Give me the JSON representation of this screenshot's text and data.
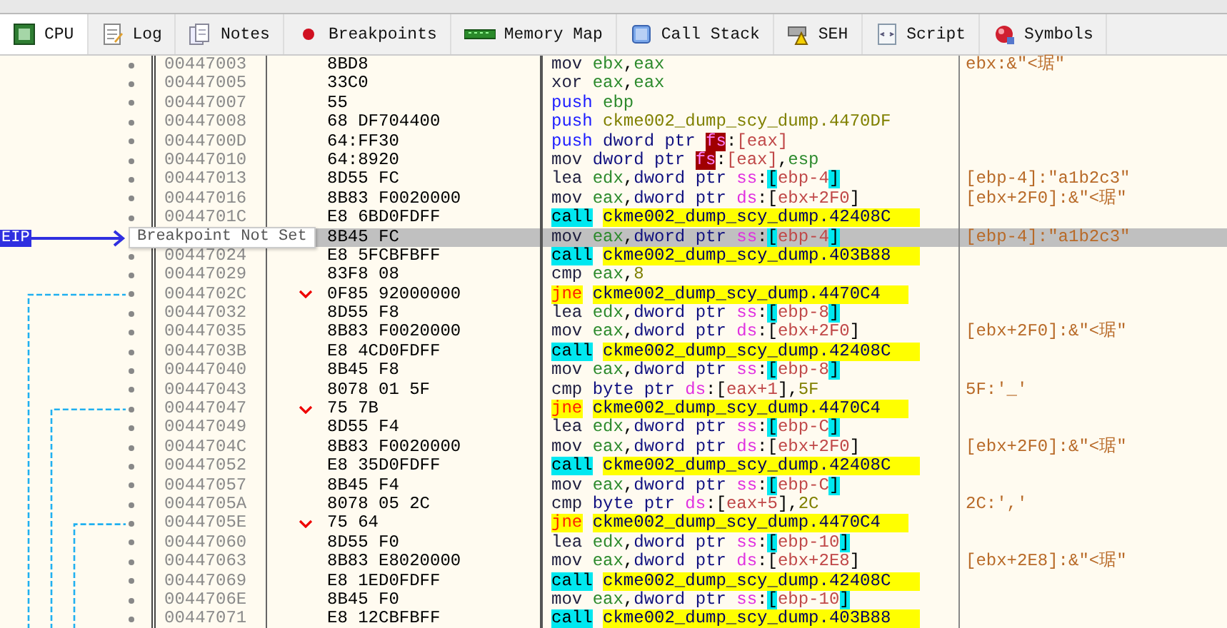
{
  "tabs": [
    {
      "label": "CPU",
      "selected": true
    },
    {
      "label": "Log",
      "selected": false
    },
    {
      "label": "Notes",
      "selected": false
    },
    {
      "label": "Breakpoints",
      "selected": false
    },
    {
      "label": "Memory Map",
      "selected": false
    },
    {
      "label": "Call Stack",
      "selected": false
    },
    {
      "label": "SEH",
      "selected": false
    },
    {
      "label": "Script",
      "selected": false
    },
    {
      "label": "Symbols",
      "selected": false
    }
  ],
  "eip_label": "EIP",
  "tooltip": "Breakpoint Not Set",
  "rows": [
    {
      "address": "00447003",
      "bytes": "8BD8",
      "mnemonic": "mov",
      "kind": "plain",
      "operands": [
        {
          "text": "ebx",
          "kind": "reg"
        },
        {
          "text": ",",
          "kind": "punct"
        },
        {
          "text": "eax",
          "kind": "reg"
        }
      ],
      "comment": "ebx:&\"<琚\"",
      "branch": false,
      "selected": false
    },
    {
      "address": "00447005",
      "bytes": "33C0",
      "mnemonic": "xor",
      "kind": "plain",
      "operands": [
        {
          "text": "eax",
          "kind": "reg"
        },
        {
          "text": ",",
          "kind": "punct"
        },
        {
          "text": "eax",
          "kind": "reg"
        }
      ],
      "branch": false,
      "selected": false
    },
    {
      "address": "00447007",
      "bytes": "55",
      "mnemonic": "push",
      "kind": "push",
      "operands": [
        {
          "text": "ebp",
          "kind": "reg"
        }
      ],
      "branch": false,
      "selected": false
    },
    {
      "address": "00447008",
      "bytes": "68 DF704400",
      "mnemonic": "push",
      "kind": "push",
      "operands": [
        {
          "text": "ckme002_dump_scy_dump.4470DF",
          "kind": "addr"
        }
      ],
      "branch": false,
      "selected": false
    },
    {
      "address": "0044700D",
      "bytes": "64:FF30",
      "mnemonic": "push",
      "kind": "push",
      "operands": [
        {
          "text": "dword ptr ",
          "kind": "ptr"
        },
        {
          "text": "fs",
          "kind": "seg-alert"
        },
        {
          "text": ":",
          "kind": "punct"
        },
        {
          "text": "[eax]",
          "kind": "mem"
        }
      ],
      "branch": false,
      "selected": false
    },
    {
      "address": "00447010",
      "bytes": "64:8920",
      "mnemonic": "mov",
      "kind": "plain",
      "operands": [
        {
          "text": "dword ptr ",
          "kind": "ptr"
        },
        {
          "text": "fs",
          "kind": "seg-alert"
        },
        {
          "text": ":",
          "kind": "punct"
        },
        {
          "text": "[eax]",
          "kind": "mem"
        },
        {
          "text": ",",
          "kind": "punct"
        },
        {
          "text": "esp",
          "kind": "reg"
        }
      ],
      "branch": false,
      "selected": false
    },
    {
      "address": "00447013",
      "bytes": "8D55 FC",
      "mnemonic": "lea",
      "kind": "plain",
      "operands": [
        {
          "text": "edx",
          "kind": "reg"
        },
        {
          "text": ",",
          "kind": "punct"
        },
        {
          "text": "dword ptr ",
          "kind": "ptr"
        },
        {
          "text": "ss",
          "kind": "seg"
        },
        {
          "text": ":",
          "kind": "punct"
        },
        {
          "text": "[",
          "kind": "bracket-mark"
        },
        {
          "text": "ebp-4",
          "kind": "mem"
        },
        {
          "text": "]",
          "kind": "bracket-mark"
        }
      ],
      "comment": "[ebp-4]:\"a1b2c3\"",
      "branch": false,
      "selected": false
    },
    {
      "address": "00447016",
      "bytes": "8B83 F0020000",
      "mnemonic": "mov",
      "kind": "plain",
      "operands": [
        {
          "text": "eax",
          "kind": "reg"
        },
        {
          "text": ",",
          "kind": "punct"
        },
        {
          "text": "dword ptr ",
          "kind": "ptr"
        },
        {
          "text": "ds",
          "kind": "seg"
        },
        {
          "text": ":",
          "kind": "punct"
        },
        {
          "text": "[",
          "kind": "punct"
        },
        {
          "text": "ebx+2F0",
          "kind": "mem"
        },
        {
          "text": "]",
          "kind": "punct"
        }
      ],
      "comment": "[ebx+2F0]:&\"<琚\"",
      "branch": false,
      "selected": false
    },
    {
      "address": "0044701C",
      "bytes": "E8 6BD0FDFF",
      "mnemonic": "call",
      "kind": "call",
      "operands": [
        {
          "text": "ckme002_dump_scy_dump.42408C",
          "kind": "label"
        }
      ],
      "branch": false,
      "selected": false
    },
    {
      "bytes": "8B45 FC",
      "mnemonic": "mov",
      "kind": "plain",
      "operands": [
        {
          "text": "eax",
          "kind": "reg"
        },
        {
          "text": ",",
          "kind": "punct"
        },
        {
          "text": "dword ptr ",
          "kind": "ptr"
        },
        {
          "text": "ss",
          "kind": "seg"
        },
        {
          "text": ":",
          "kind": "punct"
        },
        {
          "text": "[",
          "kind": "bracket-mark"
        },
        {
          "text": "ebp-4",
          "kind": "mem"
        },
        {
          "text": "]",
          "kind": "bracket-mark"
        }
      ],
      "comment": "[ebp-4]:\"a1b2c3\"",
      "branch": false,
      "selected": true
    },
    {
      "address": "00447024",
      "bytes": "E8 5FCBFBFF",
      "mnemonic": "call",
      "kind": "call",
      "operands": [
        {
          "text": "ckme002_dump_scy_dump.403B88",
          "kind": "label"
        }
      ],
      "branch": false,
      "selected": false
    },
    {
      "address": "00447029",
      "bytes": "83F8 08",
      "mnemonic": "cmp",
      "kind": "plain",
      "operands": [
        {
          "text": "eax",
          "kind": "reg"
        },
        {
          "text": ",",
          "kind": "punct"
        },
        {
          "text": "8",
          "kind": "num"
        }
      ],
      "branch": false,
      "selected": false
    },
    {
      "address": "0044702C",
      "bytes": "0F85 92000000",
      "mnemonic": "jne",
      "kind": "jump",
      "operands": [
        {
          "text": "ckme002_dump_scy_dump.4470C4",
          "kind": "label"
        }
      ],
      "branch": true,
      "selected": false
    },
    {
      "address": "00447032",
      "bytes": "8D55 F8",
      "mnemonic": "lea",
      "kind": "plain",
      "operands": [
        {
          "text": "edx",
          "kind": "reg"
        },
        {
          "text": ",",
          "kind": "punct"
        },
        {
          "text": "dword ptr ",
          "kind": "ptr"
        },
        {
          "text": "ss",
          "kind": "seg"
        },
        {
          "text": ":",
          "kind": "punct"
        },
        {
          "text": "[",
          "kind": "bracket-mark"
        },
        {
          "text": "ebp-8",
          "kind": "mem"
        },
        {
          "text": "]",
          "kind": "bracket-mark"
        }
      ],
      "branch": false,
      "selected": false
    },
    {
      "address": "00447035",
      "bytes": "8B83 F0020000",
      "mnemonic": "mov",
      "kind": "plain",
      "operands": [
        {
          "text": "eax",
          "kind": "reg"
        },
        {
          "text": ",",
          "kind": "punct"
        },
        {
          "text": "dword ptr ",
          "kind": "ptr"
        },
        {
          "text": "ds",
          "kind": "seg"
        },
        {
          "text": ":",
          "kind": "punct"
        },
        {
          "text": "[",
          "kind": "punct"
        },
        {
          "text": "ebx+2F0",
          "kind": "mem"
        },
        {
          "text": "]",
          "kind": "punct"
        }
      ],
      "comment": "[ebx+2F0]:&\"<琚\"",
      "branch": false,
      "selected": false
    },
    {
      "address": "0044703B",
      "bytes": "E8 4CD0FDFF",
      "mnemonic": "call",
      "kind": "call",
      "operands": [
        {
          "text": "ckme002_dump_scy_dump.42408C",
          "kind": "label"
        }
      ],
      "branch": false,
      "selected": false
    },
    {
      "address": "00447040",
      "bytes": "8B45 F8",
      "mnemonic": "mov",
      "kind": "plain",
      "operands": [
        {
          "text": "eax",
          "kind": "reg"
        },
        {
          "text": ",",
          "kind": "punct"
        },
        {
          "text": "dword ptr ",
          "kind": "ptr"
        },
        {
          "text": "ss",
          "kind": "seg"
        },
        {
          "text": ":",
          "kind": "punct"
        },
        {
          "text": "[",
          "kind": "bracket-mark"
        },
        {
          "text": "ebp-8",
          "kind": "mem"
        },
        {
          "text": "]",
          "kind": "bracket-mark"
        }
      ],
      "branch": false,
      "selected": false
    },
    {
      "address": "00447043",
      "bytes": "8078 01 5F",
      "mnemonic": "cmp",
      "kind": "plain",
      "operands": [
        {
          "text": "byte ptr ",
          "kind": "ptr"
        },
        {
          "text": "ds",
          "kind": "seg"
        },
        {
          "text": ":",
          "kind": "punct"
        },
        {
          "text": "[",
          "kind": "punct"
        },
        {
          "text": "eax+1",
          "kind": "mem"
        },
        {
          "text": "]",
          "kind": "punct"
        },
        {
          "text": ",",
          "kind": "punct"
        },
        {
          "text": "5F",
          "kind": "num"
        }
      ],
      "comment": "5F:'_'",
      "branch": false,
      "selected": false
    },
    {
      "address": "00447047",
      "bytes": "75 7B",
      "mnemonic": "jne",
      "kind": "jump",
      "operands": [
        {
          "text": "ckme002_dump_scy_dump.4470C4",
          "kind": "label"
        }
      ],
      "branch": true,
      "selected": false
    },
    {
      "address": "00447049",
      "bytes": "8D55 F4",
      "mnemonic": "lea",
      "kind": "plain",
      "operands": [
        {
          "text": "edx",
          "kind": "reg"
        },
        {
          "text": ",",
          "kind": "punct"
        },
        {
          "text": "dword ptr ",
          "kind": "ptr"
        },
        {
          "text": "ss",
          "kind": "seg"
        },
        {
          "text": ":",
          "kind": "punct"
        },
        {
          "text": "[",
          "kind": "bracket-mark"
        },
        {
          "text": "ebp-C",
          "kind": "mem"
        },
        {
          "text": "]",
          "kind": "bracket-mark"
        }
      ],
      "branch": false,
      "selected": false
    },
    {
      "address": "0044704C",
      "bytes": "8B83 F0020000",
      "mnemonic": "mov",
      "kind": "plain",
      "operands": [
        {
          "text": "eax",
          "kind": "reg"
        },
        {
          "text": ",",
          "kind": "punct"
        },
        {
          "text": "dword ptr ",
          "kind": "ptr"
        },
        {
          "text": "ds",
          "kind": "seg"
        },
        {
          "text": ":",
          "kind": "punct"
        },
        {
          "text": "[",
          "kind": "punct"
        },
        {
          "text": "ebx+2F0",
          "kind": "mem"
        },
        {
          "text": "]",
          "kind": "punct"
        }
      ],
      "comment": "[ebx+2F0]:&\"<琚\"",
      "branch": false,
      "selected": false
    },
    {
      "address": "00447052",
      "bytes": "E8 35D0FDFF",
      "mnemonic": "call",
      "kind": "call",
      "operands": [
        {
          "text": "ckme002_dump_scy_dump.42408C",
          "kind": "label"
        }
      ],
      "branch": false,
      "selected": false
    },
    {
      "address": "00447057",
      "bytes": "8B45 F4",
      "mnemonic": "mov",
      "kind": "plain",
      "operands": [
        {
          "text": "eax",
          "kind": "reg"
        },
        {
          "text": ",",
          "kind": "punct"
        },
        {
          "text": "dword ptr ",
          "kind": "ptr"
        },
        {
          "text": "ss",
          "kind": "seg"
        },
        {
          "text": ":",
          "kind": "punct"
        },
        {
          "text": "[",
          "kind": "bracket-mark"
        },
        {
          "text": "ebp-C",
          "kind": "mem"
        },
        {
          "text": "]",
          "kind": "bracket-mark"
        }
      ],
      "branch": false,
      "selected": false
    },
    {
      "address": "0044705A",
      "bytes": "8078 05 2C",
      "mnemonic": "cmp",
      "kind": "plain",
      "operands": [
        {
          "text": "byte ptr ",
          "kind": "ptr"
        },
        {
          "text": "ds",
          "kind": "seg"
        },
        {
          "text": ":",
          "kind": "punct"
        },
        {
          "text": "[",
          "kind": "punct"
        },
        {
          "text": "eax+5",
          "kind": "mem"
        },
        {
          "text": "]",
          "kind": "punct"
        },
        {
          "text": ",",
          "kind": "punct"
        },
        {
          "text": "2C",
          "kind": "num"
        }
      ],
      "comment": "2C:','",
      "branch": false,
      "selected": false
    },
    {
      "address": "0044705E",
      "bytes": "75 64",
      "mnemonic": "jne",
      "kind": "jump",
      "operands": [
        {
          "text": "ckme002_dump_scy_dump.4470C4",
          "kind": "label"
        }
      ],
      "branch": true,
      "selected": false
    },
    {
      "address": "00447060",
      "bytes": "8D55 F0",
      "mnemonic": "lea",
      "kind": "plain",
      "operands": [
        {
          "text": "edx",
          "kind": "reg"
        },
        {
          "text": ",",
          "kind": "punct"
        },
        {
          "text": "dword ptr ",
          "kind": "ptr"
        },
        {
          "text": "ss",
          "kind": "seg"
        },
        {
          "text": ":",
          "kind": "punct"
        },
        {
          "text": "[",
          "kind": "bracket-mark"
        },
        {
          "text": "ebp-10",
          "kind": "mem"
        },
        {
          "text": "]",
          "kind": "bracket-mark"
        }
      ],
      "branch": false,
      "selected": false
    },
    {
      "address": "00447063",
      "bytes": "8B83 E8020000",
      "mnemonic": "mov",
      "kind": "plain",
      "operands": [
        {
          "text": "eax",
          "kind": "reg"
        },
        {
          "text": ",",
          "kind": "punct"
        },
        {
          "text": "dword ptr ",
          "kind": "ptr"
        },
        {
          "text": "ds",
          "kind": "seg"
        },
        {
          "text": ":",
          "kind": "punct"
        },
        {
          "text": "[",
          "kind": "punct"
        },
        {
          "text": "ebx+2E8",
          "kind": "mem"
        },
        {
          "text": "]",
          "kind": "punct"
        }
      ],
      "comment": "[ebx+2E8]:&\"<琚\"",
      "branch": false,
      "selected": false
    },
    {
      "address": "00447069",
      "bytes": "E8 1ED0FDFF",
      "mnemonic": "call",
      "kind": "call",
      "operands": [
        {
          "text": "ckme002_dump_scy_dump.42408C",
          "kind": "label"
        }
      ],
      "branch": false,
      "selected": false
    },
    {
      "address": "0044706E",
      "bytes": "8B45 F0",
      "mnemonic": "mov",
      "kind": "plain",
      "operands": [
        {
          "text": "eax",
          "kind": "reg"
        },
        {
          "text": ",",
          "kind": "punct"
        },
        {
          "text": "dword ptr ",
          "kind": "ptr"
        },
        {
          "text": "ss",
          "kind": "seg"
        },
        {
          "text": ":",
          "kind": "punct"
        },
        {
          "text": "[",
          "kind": "bracket-mark"
        },
        {
          "text": "ebp-10",
          "kind": "mem"
        },
        {
          "text": "]",
          "kind": "bracket-mark"
        }
      ],
      "branch": false,
      "selected": false
    },
    {
      "address": "00447071",
      "bytes": "E8 12CBFBFF",
      "mnemonic": "call",
      "kind": "call",
      "operands": [
        {
          "text": "ckme002_dump_scy_dump.403B88",
          "kind": "label"
        }
      ],
      "branch": false,
      "selected": false
    }
  ]
}
